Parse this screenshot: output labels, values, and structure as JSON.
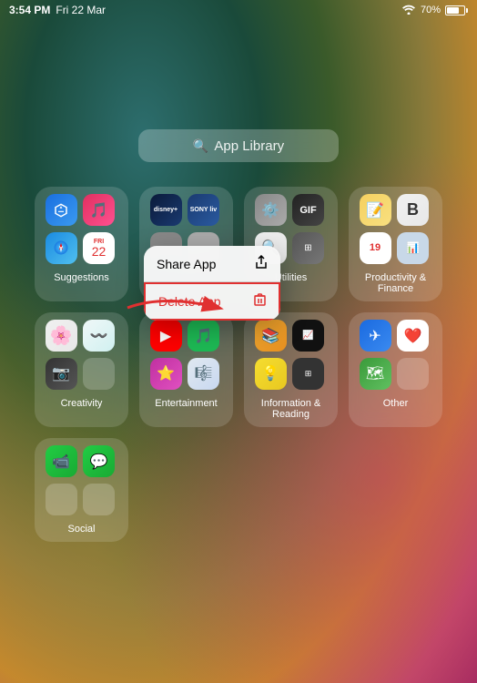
{
  "statusBar": {
    "time": "3:54 PM",
    "date": "Fri 22 Mar",
    "battery": "70%"
  },
  "searchBar": {
    "placeholder": "App Library",
    "icon": "search-icon"
  },
  "contextMenu": {
    "shareLabel": "Share App",
    "deleteLabel": "Delete App"
  },
  "folders": [
    {
      "id": "suggestions",
      "label": "Suggestions"
    },
    {
      "id": "utilities",
      "label": "Utilities"
    },
    {
      "id": "productivity",
      "label": "Productivity & Finance"
    },
    {
      "id": "creativity",
      "label": "Creativity"
    },
    {
      "id": "entertainment",
      "label": "Entertainment"
    },
    {
      "id": "information",
      "label": "Information & Reading"
    },
    {
      "id": "other",
      "label": "Other"
    },
    {
      "id": "social",
      "label": "Social"
    }
  ]
}
